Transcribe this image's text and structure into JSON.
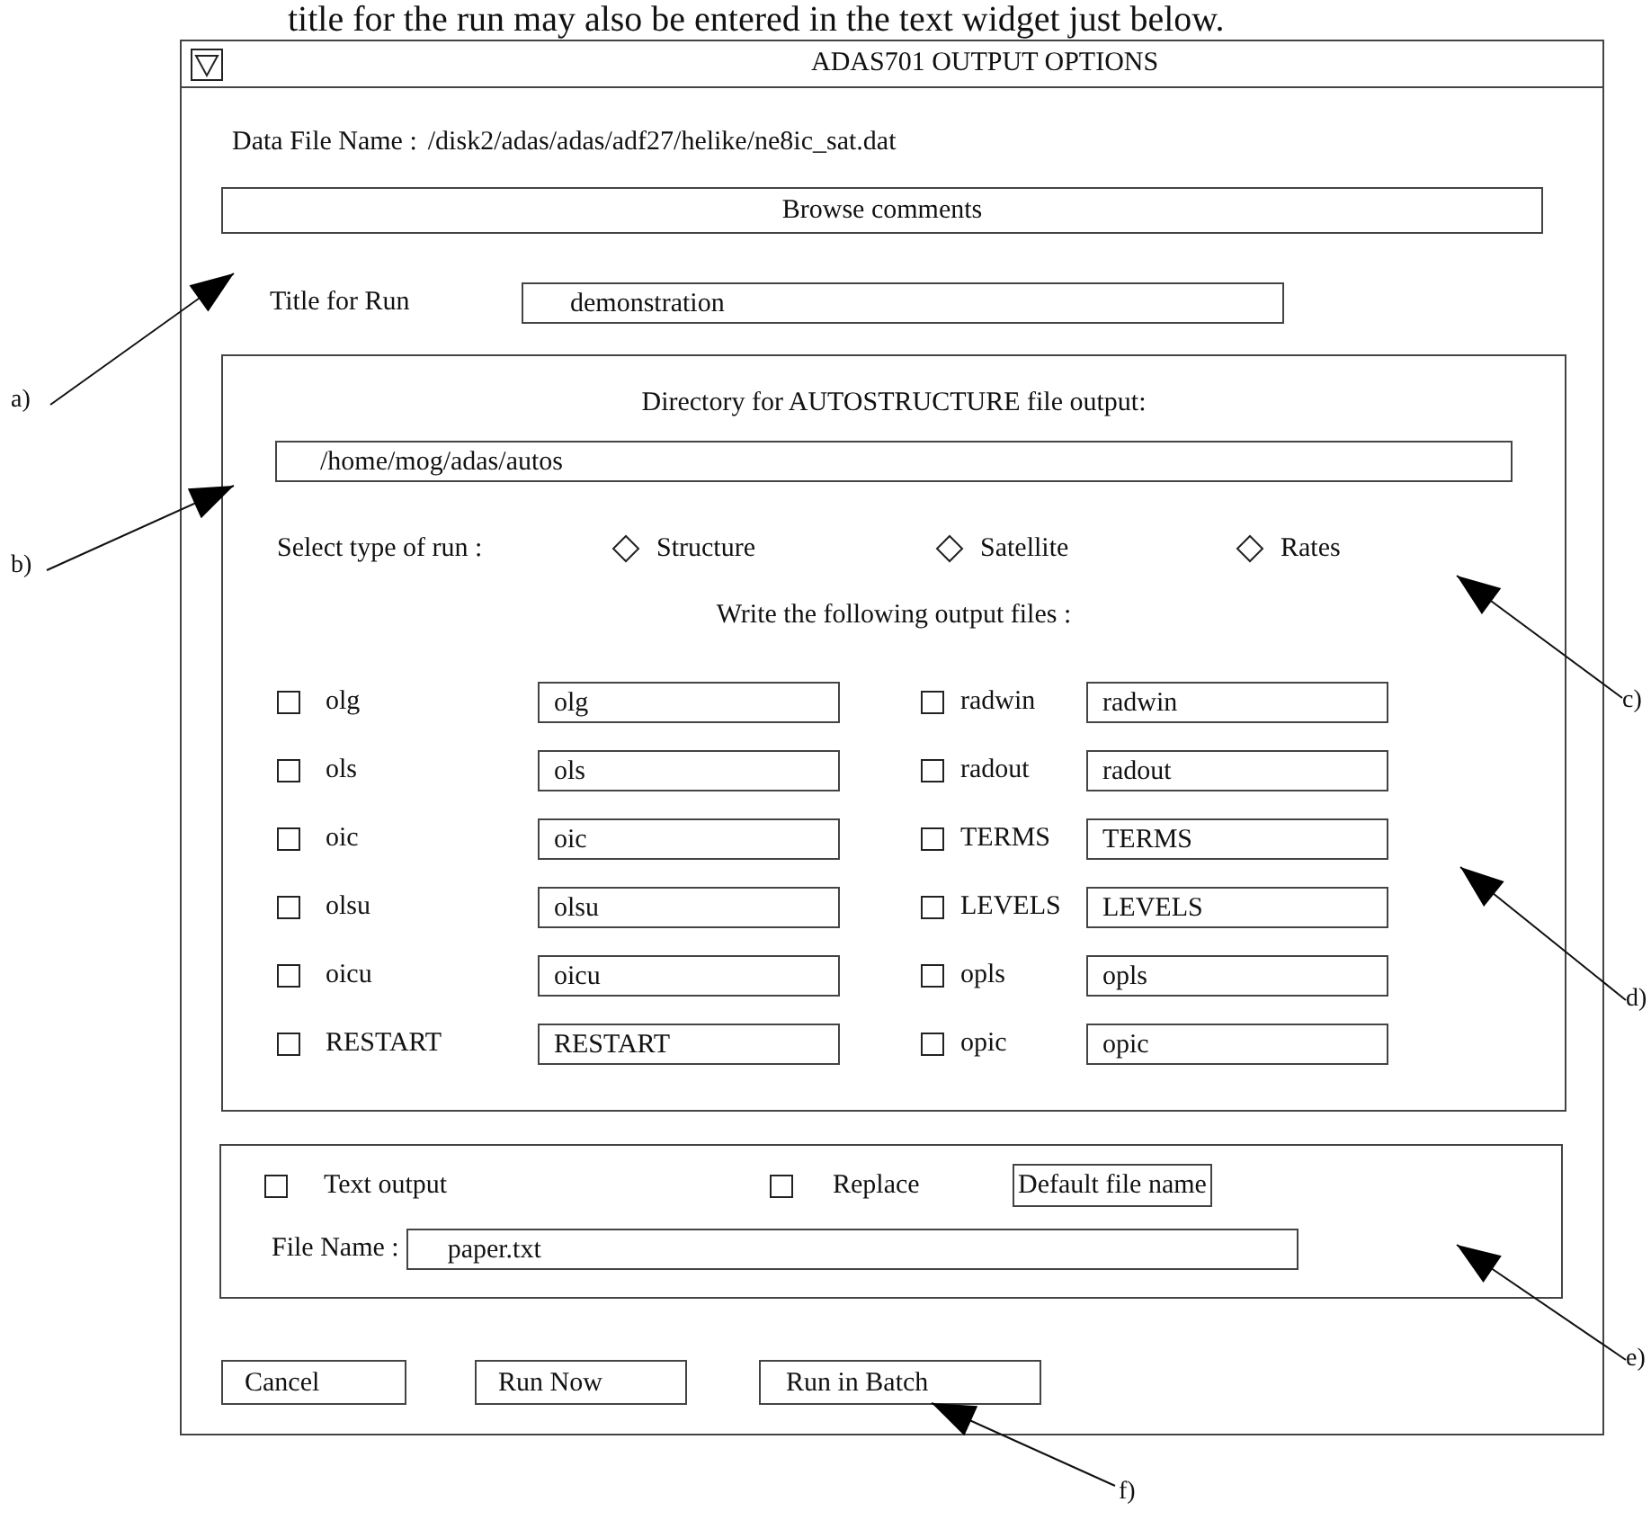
{
  "caption": "title for the run may also be entered in the text widget just below.",
  "window": {
    "title": "ADAS701  OUTPUT OPTIONS"
  },
  "data_file": {
    "label": "Data File Name  :",
    "value": "/disk2/adas/adas/adf27/helike/ne8ic_sat.dat"
  },
  "browse_button": "Browse comments",
  "title_for_run": {
    "label": "Title for Run",
    "value": "demonstration"
  },
  "directory": {
    "label": "Directory for AUTOSTRUCTURE  file output:",
    "value": "/home/mog/adas/autos"
  },
  "run_type": {
    "label": "Select type of run :",
    "options": [
      {
        "label": "Structure",
        "selected": false
      },
      {
        "label": "Satellite",
        "selected": false
      },
      {
        "label": "Rates",
        "selected": false
      }
    ]
  },
  "output_files": {
    "heading": "Write the following output files :",
    "left": [
      {
        "label": "olg",
        "value": "olg",
        "checked": false
      },
      {
        "label": "ols",
        "value": "ols",
        "checked": false
      },
      {
        "label": "oic",
        "value": "oic",
        "checked": false
      },
      {
        "label": "olsu",
        "value": "olsu",
        "checked": false
      },
      {
        "label": "oicu",
        "value": "oicu",
        "checked": false
      },
      {
        "label": "RESTART",
        "value": "RESTART",
        "checked": false
      }
    ],
    "right": [
      {
        "label": "radwin",
        "value": "radwin",
        "checked": false
      },
      {
        "label": "radout",
        "value": "radout",
        "checked": false
      },
      {
        "label": "TERMS",
        "value": "TERMS",
        "checked": false
      },
      {
        "label": "LEVELS",
        "value": "LEVELS",
        "checked": false
      },
      {
        "label": "opls",
        "value": "opls",
        "checked": false
      },
      {
        "label": "opic",
        "value": "opic",
        "checked": false
      }
    ]
  },
  "text_output": {
    "text_output": {
      "label": "Text output",
      "checked": false
    },
    "replace": {
      "label": "Replace",
      "checked": false
    },
    "default_button": "Default file name",
    "file_name": {
      "label": "File Name  :",
      "value": "paper.txt"
    }
  },
  "buttons": [
    "Cancel",
    "Run Now",
    "Run in Batch"
  ],
  "annotations": [
    "a)",
    "b)",
    "c)",
    "d)",
    "e)",
    "f)"
  ]
}
